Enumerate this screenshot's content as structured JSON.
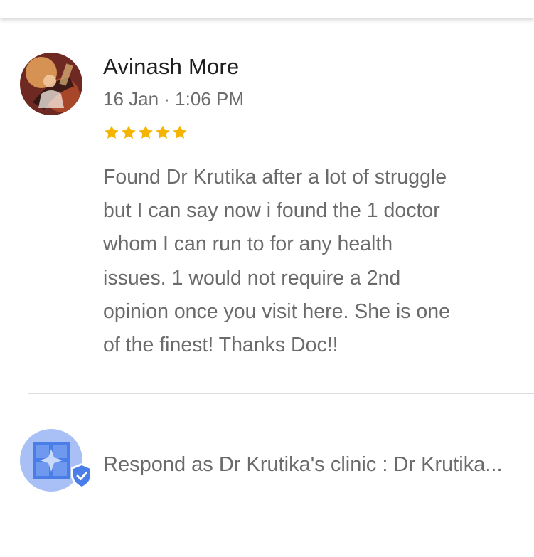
{
  "review": {
    "author_name": "Avinash More",
    "date": "16 Jan · 1:06 PM",
    "rating": 5,
    "rating_max": 5,
    "text": "Found Dr Krutika after a lot of struggle\nbut I can say now i found the 1 doctor\nwhom I can run to for any health\nissues. 1 would not require a 2nd\nopinion once you visit here. She is one\nof the finest! Thanks Doc!!"
  },
  "respond": {
    "placeholder": "Respond as Dr Krutika's clinic : Dr Krutika..."
  },
  "colors": {
    "star": "#F4B400",
    "secondary_text": "#6b6b6b",
    "primary_text": "#1f1f1f",
    "owner_avatar_bg": "#a8c0f5",
    "owner_avatar_icon": "#4a7de8",
    "verified_badge": "#4a7de8",
    "divider": "#dadce0"
  },
  "icons": {
    "author_avatar": "user-photo",
    "owner_avatar": "business-storefront-icon",
    "verified": "verified-check-icon",
    "star": "star-icon"
  }
}
